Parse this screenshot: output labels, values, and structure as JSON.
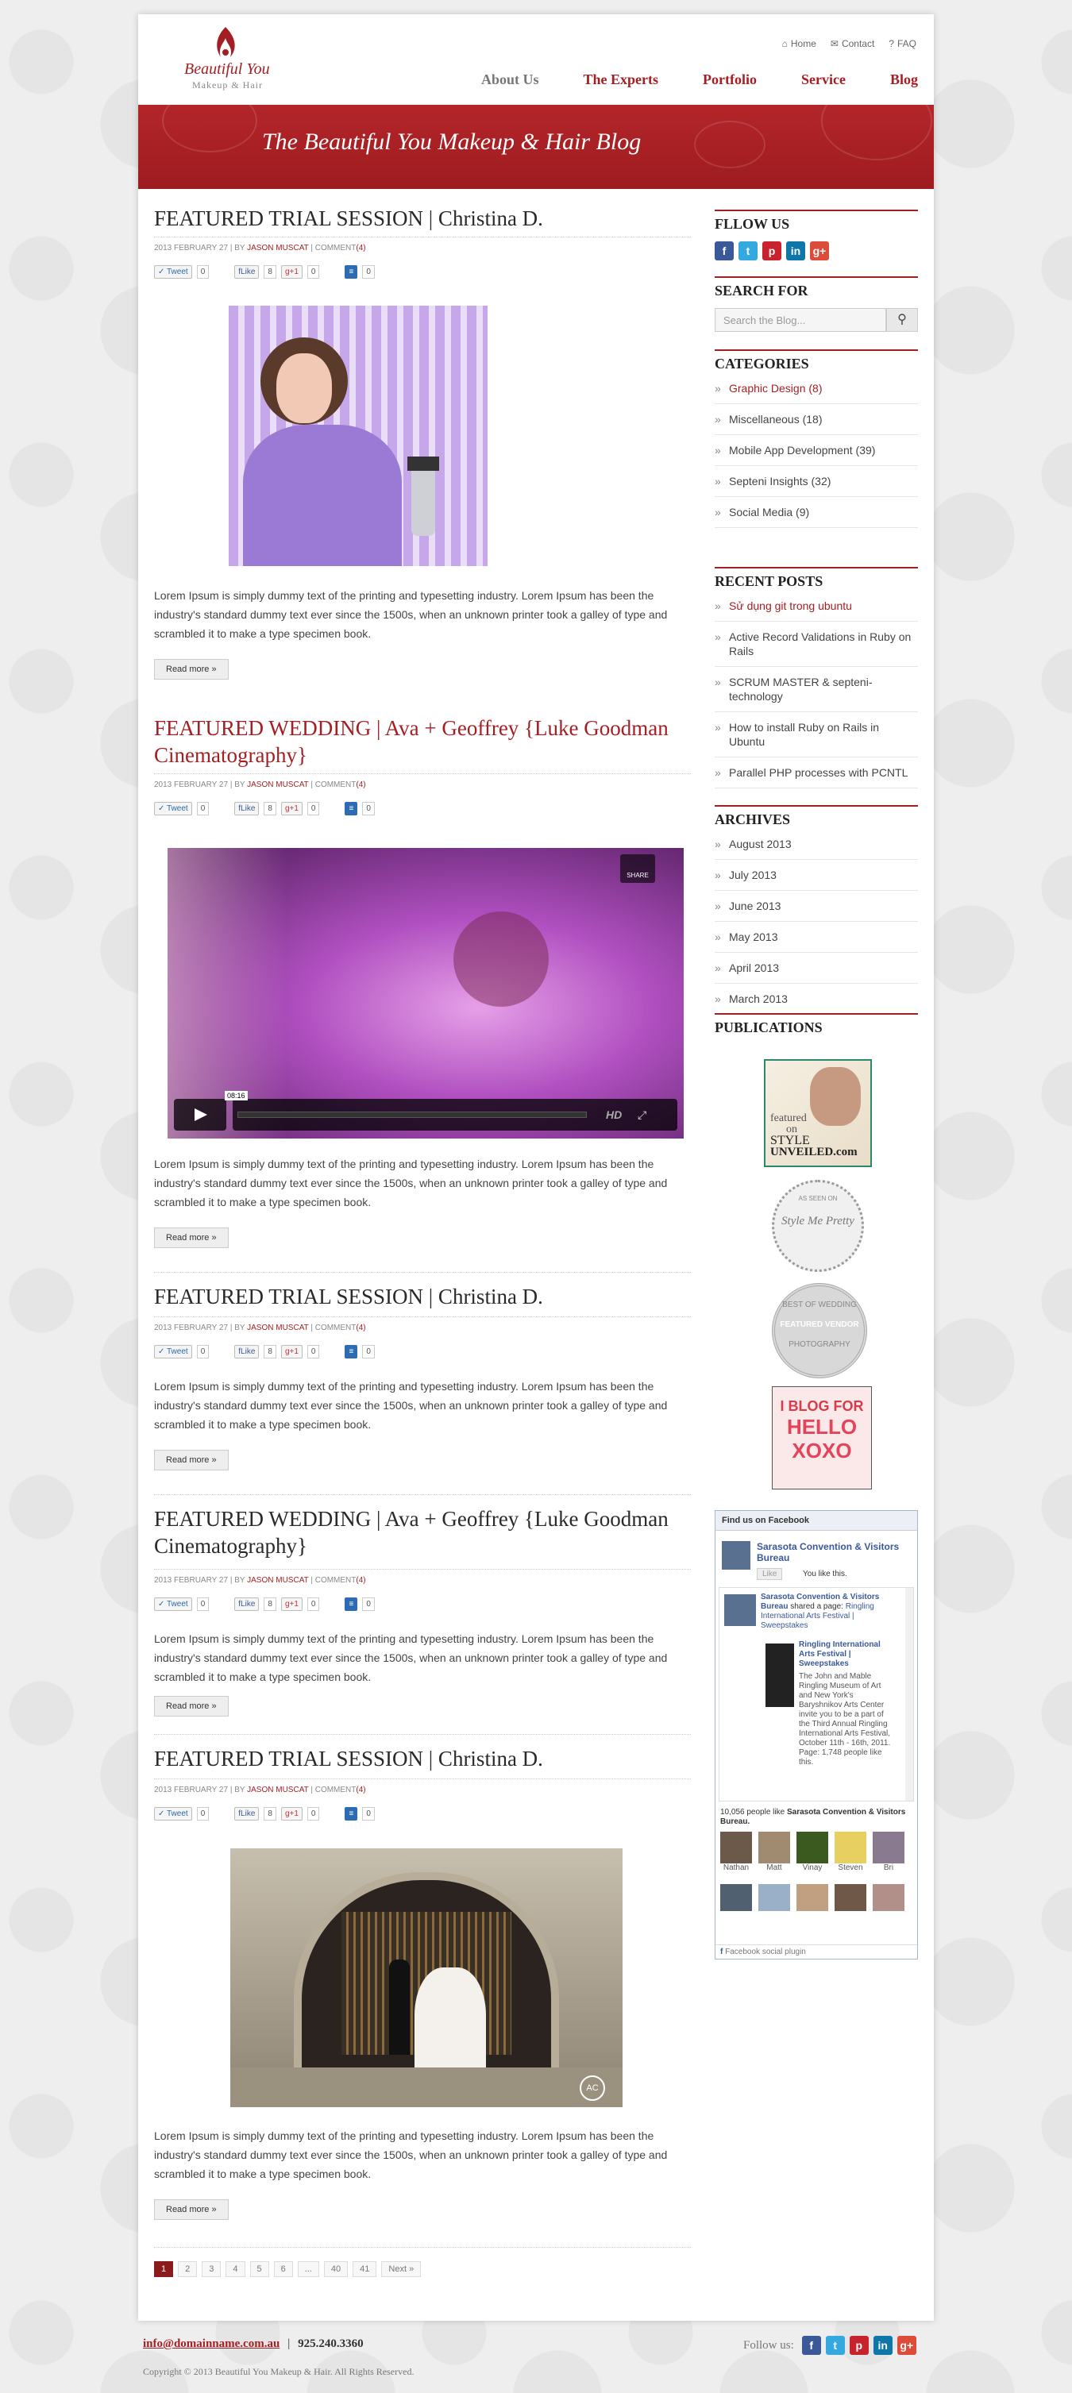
{
  "header": {
    "logo_title": "Beautiful You",
    "logo_sub": "Makeup & Hair",
    "top_links": [
      "Home",
      "Contact",
      "FAQ"
    ],
    "nav": [
      "About Us",
      "The Experts",
      "Portfolio",
      "Service",
      "Blog"
    ],
    "banner_title": "The  Beautiful You Makeup & Hair Blog"
  },
  "posts": [
    {
      "title": "FEATURED TRIAL SESSION | Christina D.",
      "date": "2013 FEBRUARY 27",
      "by": "| BY",
      "author": "JASON MUSCAT",
      "comment_label": "| COMMENT",
      "comments": "(4)",
      "excerpt": "Lorem Ipsum is simply dummy text of the printing and typesetting industry. Lorem Ipsum has been the industry's standard dummy text ever since the 1500s, when an unknown printer took a galley of type and scrambled it to make a type specimen book.",
      "read_more": "Read more »"
    },
    {
      "title": "FEATURED WEDDING | Ava + Geoffrey {Luke Goodman Cinematography}",
      "date": "2013 FEBRUARY 27",
      "by": "| BY",
      "author": "JASON MUSCAT",
      "comment_label": "| COMMENT",
      "comments": "(4)",
      "excerpt": "Lorem Ipsum is simply dummy text of the printing and typesetting industry. Lorem Ipsum has been the industry's standard dummy text ever since the 1500s, when an unknown printer took a galley of type and scrambled it to make a type specimen book.",
      "read_more": "Read more »",
      "video_time": "08:16",
      "video_share": "SHARE",
      "video_hd": "HD"
    },
    {
      "title": "FEATURED TRIAL SESSION | Christina D.",
      "date": "2013 FEBRUARY 27",
      "by": "| BY",
      "author": "JASON MUSCAT",
      "comment_label": "| COMMENT",
      "comments": "(4)",
      "excerpt": "Lorem Ipsum is simply dummy text of the printing and typesetting industry. Lorem Ipsum has been the industry's standard dummy text ever since the 1500s, when an unknown printer took a galley of type and scrambled it to make a type specimen book.",
      "read_more": "Read more »"
    },
    {
      "title": "FEATURED WEDDING | Ava + Geoffrey {Luke Goodman Cinematography}",
      "date": "2013 FEBRUARY 27",
      "by": "| BY",
      "author": "JASON MUSCAT",
      "comment_label": "| COMMENT",
      "comments": "(4)",
      "excerpt": "Lorem Ipsum is simply dummy text of the printing and typesetting industry. Lorem Ipsum has been the industry's standard dummy text ever since the 1500s, when an unknown printer took a galley of type and scrambled it to make a type specimen book.",
      "read_more": "Read more »"
    },
    {
      "title": "FEATURED TRIAL SESSION | Christina D.",
      "date": "2013 FEBRUARY 27",
      "by": "| BY",
      "author": "JASON MUSCAT",
      "comment_label": "| COMMENT",
      "comments": "(4)",
      "excerpt": "Lorem Ipsum is simply dummy text of the printing and typesetting industry. Lorem Ipsum has been the industry's standard dummy text ever since the 1500s, when an unknown printer took a galley of type and scrambled it to make a type specimen book.",
      "read_more": "Read more »",
      "photo_badge": "AC"
    }
  ],
  "social": {
    "tweet": "Tweet",
    "tweet_count": "0",
    "like": "Like",
    "like_count": "8",
    "plus": "+1",
    "plus_count": "0",
    "buffer_count": "0"
  },
  "pagination": [
    "1",
    "2",
    "3",
    "4",
    "5",
    "6",
    "...",
    "40",
    "41",
    "Next »"
  ],
  "sidebar": {
    "follow_title": "FLLOW US",
    "search_title": "SEARCH FOR",
    "search_placeholder": "Search the Blog...",
    "categories_title": "CATEGORIES",
    "categories": [
      "Graphic Design (8)",
      "Miscellaneous (18)",
      "Mobile App Development (39)",
      "Septeni Insights (32)",
      "Social Media (9)"
    ],
    "recent_title": "RECENT POSTS",
    "recent": [
      "Sử dụng git trong ubuntu",
      "Active Record Validations in Ruby on Rails",
      "SCRUM MASTER & septeni-technology",
      "How to install Ruby on Rails in Ubuntu",
      "Parallel PHP processes with PCNTL"
    ],
    "archives_title": "ARCHIVES",
    "archives": [
      "August 2013",
      "July 2013",
      "June 2013",
      "May 2013",
      "April 2013",
      "March 2013"
    ],
    "publications_title": "PUBLICATIONS",
    "pub1": [
      "featured",
      "on",
      "STYLE",
      "UNVEILED.com"
    ],
    "pub2": "Style Me Pretty",
    "pub2_ring": "AS SEEN ON",
    "pub3": [
      "BEST OF WEDDING",
      "FEATURED VENDOR",
      "PHOTOGRAPHY"
    ],
    "pub4": [
      "I BLOG FOR",
      "HELLO",
      "XOXO"
    ],
    "fb_header": "Find us on Facebook",
    "fb_page": "Sarasota Convention & Visitors Bureau",
    "fb_like": "Like",
    "fb_you_like": "You like this.",
    "fb_post_author": "Sarasota Convention & Visitors Bureau",
    "fb_post_action": "shared a page:",
    "fb_post_page": "Ringling International Arts Festival | Sweepstakes",
    "fb_post_title": "Ringling International Arts Festival | Sweepstakes",
    "fb_post_body": "The John and Mable Ringling Museum of Art and New York's Baryshnikov Arts Center invite you to be a part of the Third Annual Ringling International Arts Festival, October 11th - 16th, 2011.",
    "fb_post_page_label": "Page:",
    "fb_post_likes": "1,748 people like this.",
    "fb_count": "10,056 people like",
    "fb_count_page": "Sarasota Convention & Visitors Bureau.",
    "fb_faces": [
      "Nathan",
      "Matt",
      "Vinay",
      "Steven",
      "Bri"
    ],
    "fb_plugin": "Facebook social plugin"
  },
  "footer": {
    "email": "info@domainname.com.au",
    "phone": "925.240.3360",
    "follow": "Follow us:",
    "copyright": "Copyright © 2013 Beautiful You Makeup & Hair. All Rights Reserved."
  },
  "colors": {
    "brand_red": "#a41f24",
    "banner_red": "#a8202a",
    "facebook_blue": "#3b5998"
  }
}
